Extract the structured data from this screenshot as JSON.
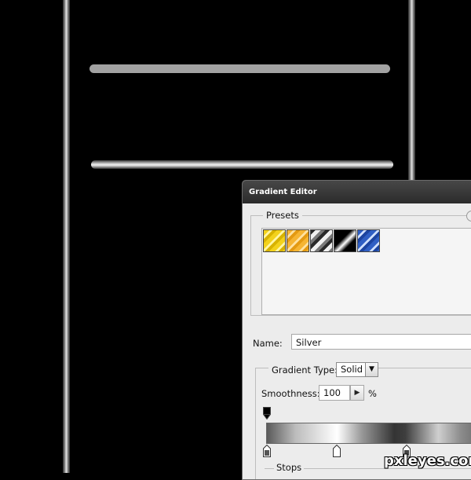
{
  "dialog": {
    "title": "Gradient Editor",
    "presets_label": "Presets",
    "presets": [
      {
        "name": "yellow-gradient",
        "color": "#f3d21c"
      },
      {
        "name": "orange-gradient",
        "color": "#f6b533"
      },
      {
        "name": "silver-gradient",
        "color": "#9a9a9a"
      },
      {
        "name": "black-white-gradient",
        "color": "#000000"
      },
      {
        "name": "blue-gradient",
        "color": "#2f5fc4"
      }
    ],
    "name_label": "Name:",
    "name_value": "Silver",
    "gradient_type_label": "Gradient Type:",
    "gradient_type_value": "Solid",
    "smoothness_label": "Smoothness:",
    "smoothness_value": "100",
    "smoothness_unit": "%",
    "stops_label": "Stops"
  },
  "watermark": "pxleyes.com"
}
